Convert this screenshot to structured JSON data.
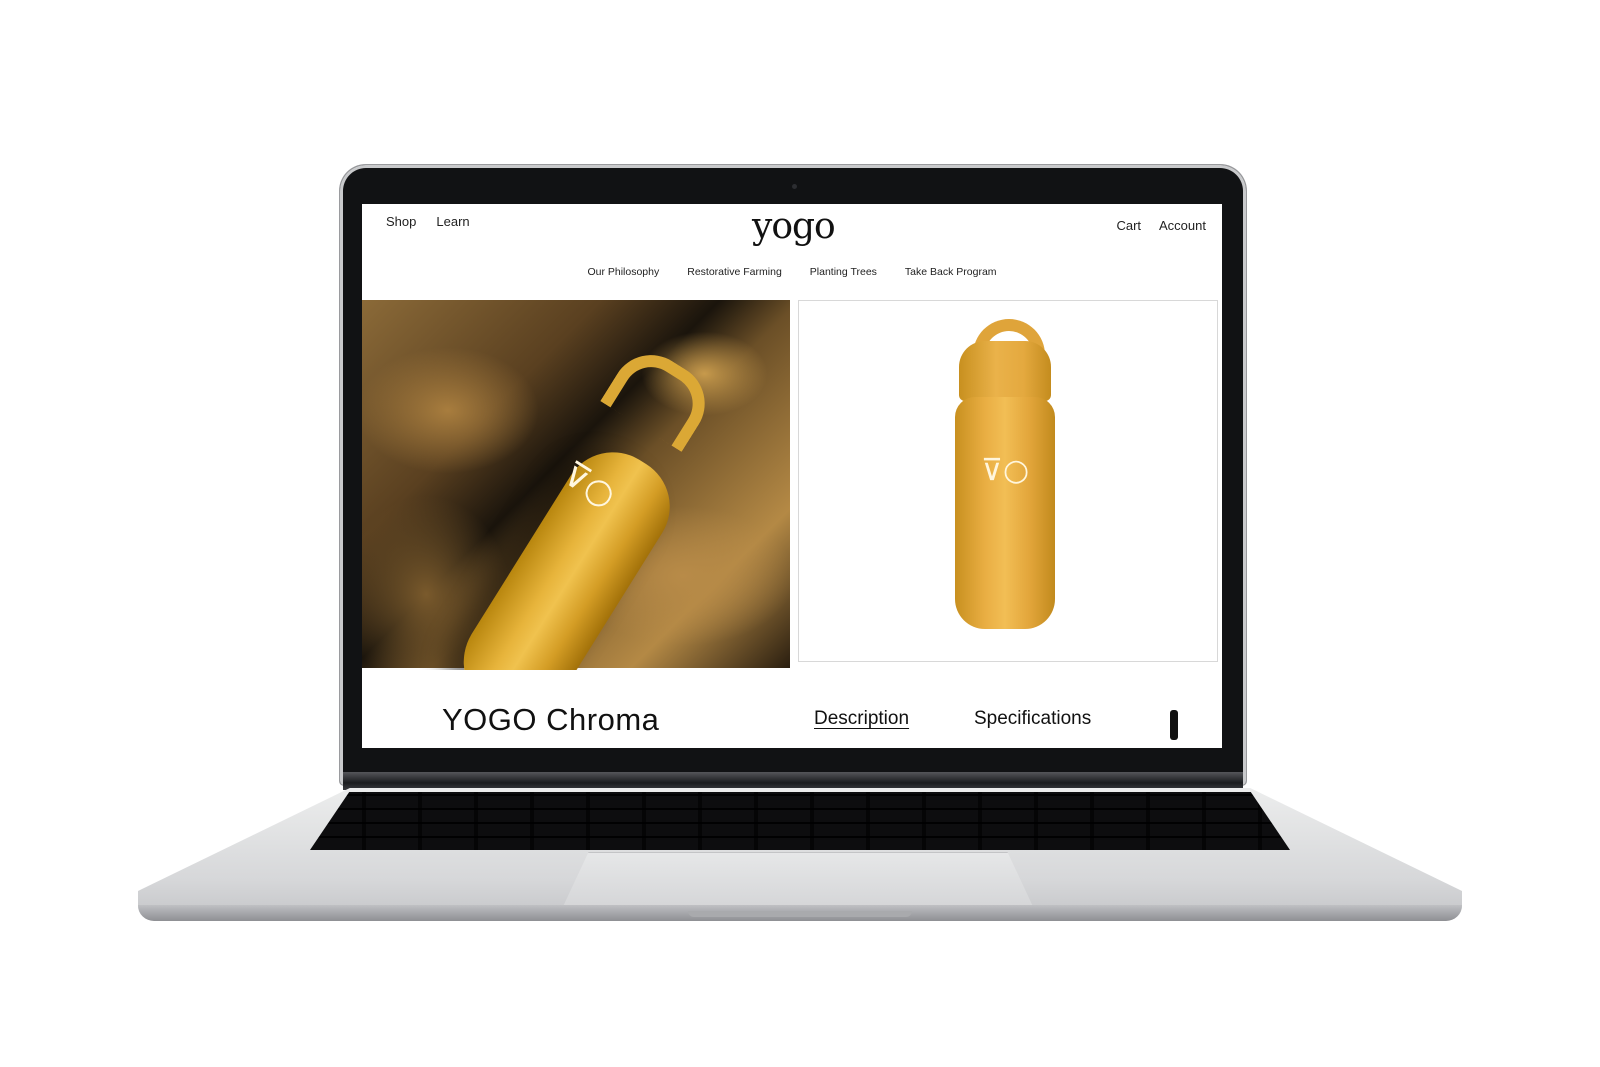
{
  "header": {
    "nav_left": [
      "Shop",
      "Learn"
    ],
    "logo": "yogo",
    "nav_right": [
      "Cart",
      "Account"
    ]
  },
  "subnav": [
    "Our Philosophy",
    "Restorative Farming",
    "Planting Trees",
    "Take Back Program"
  ],
  "product": {
    "title": "YOGO Chroma",
    "tabs": [
      "Description",
      "Specifications"
    ],
    "active_tab": "Description",
    "color": "#e6a93e"
  }
}
